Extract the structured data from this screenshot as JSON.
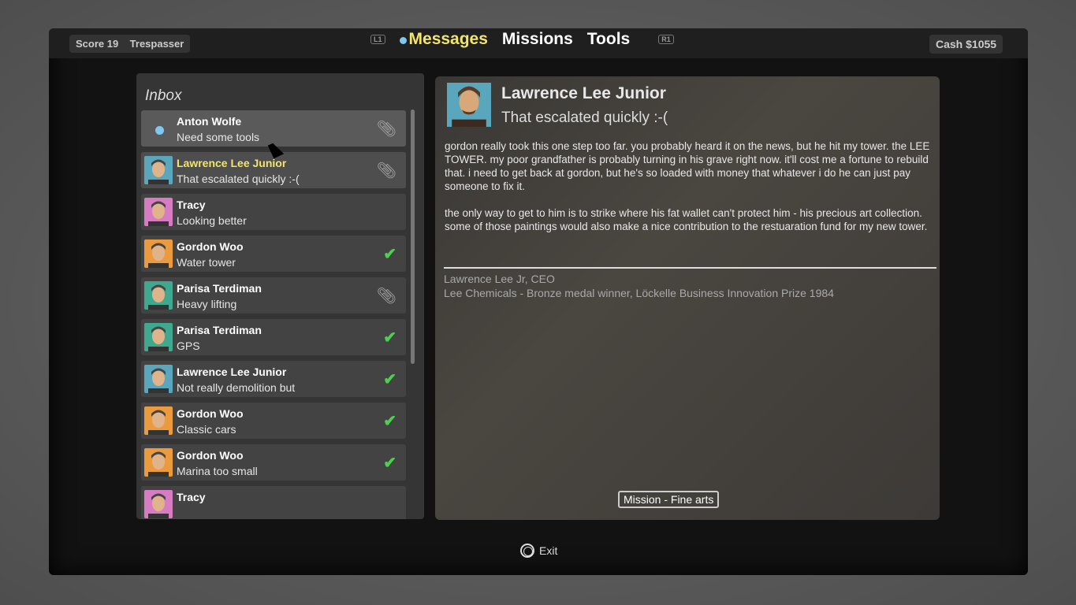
{
  "topbar": {
    "score": "Score 19",
    "rank": "Trespasser",
    "l1": "L1",
    "r1": "R1",
    "tabs": [
      "Messages",
      "Missions",
      "Tools"
    ],
    "cash": "Cash $1055"
  },
  "inbox": {
    "title": "Inbox",
    "items": [
      {
        "name": "Anton Wolfe",
        "subject": "Need some tools",
        "status": "unread",
        "icon": "paperclip-icon",
        "avatar_color": "#5a5a5a"
      },
      {
        "name": "Lawrence Lee Junior",
        "subject": "That escalated quickly :-(",
        "status": "selected",
        "icon": "paperclip-icon",
        "avatar_color": "#5aa6bd"
      },
      {
        "name": "Tracy",
        "subject": "Looking better",
        "status": "",
        "icon": "",
        "avatar_color": "#d77bc2"
      },
      {
        "name": "Gordon Woo",
        "subject": "Water tower",
        "status": "",
        "icon": "check-icon",
        "avatar_color": "#eb9b3e"
      },
      {
        "name": "Parisa Terdiman",
        "subject": "Heavy lifting",
        "status": "",
        "icon": "paperclip-icon",
        "avatar_color": "#3fa88f"
      },
      {
        "name": "Parisa Terdiman",
        "subject": "GPS",
        "status": "",
        "icon": "check-icon",
        "avatar_color": "#3fa88f"
      },
      {
        "name": "Lawrence Lee Junior",
        "subject": "Not really demolition but",
        "status": "",
        "icon": "check-icon",
        "avatar_color": "#5aa6bd"
      },
      {
        "name": "Gordon Woo",
        "subject": "Classic cars",
        "status": "",
        "icon": "check-icon",
        "avatar_color": "#eb9b3e"
      },
      {
        "name": "Gordon Woo",
        "subject": "Marina too small",
        "status": "",
        "icon": "check-icon",
        "avatar_color": "#eb9b3e"
      },
      {
        "name": "Tracy",
        "subject": "",
        "status": "",
        "icon": "",
        "avatar_color": "#d77bc2"
      }
    ]
  },
  "message": {
    "sender": "Lawrence Lee Junior",
    "subject": "That escalated quickly :-(",
    "paragraphs": [
      "gordon really took this one step too far. you probably heard it on the news, but he hit my tower. the LEE TOWER. my poor grandfather is probably turning in his grave right now. it'll cost me a fortune to rebuild that. i need to get back at gordon, but he's so loaded with money that whatever i do he can just pay someone to fix it.",
      "the only way to get to him is to strike where his fat wallet can't protect him - his precious art collection. some of those paintings would also make a nice contribution to the restuaration fund for my new tower."
    ],
    "signature": [
      "Lawrence Lee Jr, CEO",
      "Lee Chemicals - Bronze medal winner, Löckelle Business Innovation Prize 1984"
    ],
    "mission_button": "Mission - Fine arts"
  },
  "footer": {
    "exit": "Exit"
  },
  "colors": {
    "accent": "#f2e56a",
    "unread_dot": "#7ec8f0",
    "check": "#4bd14b"
  }
}
